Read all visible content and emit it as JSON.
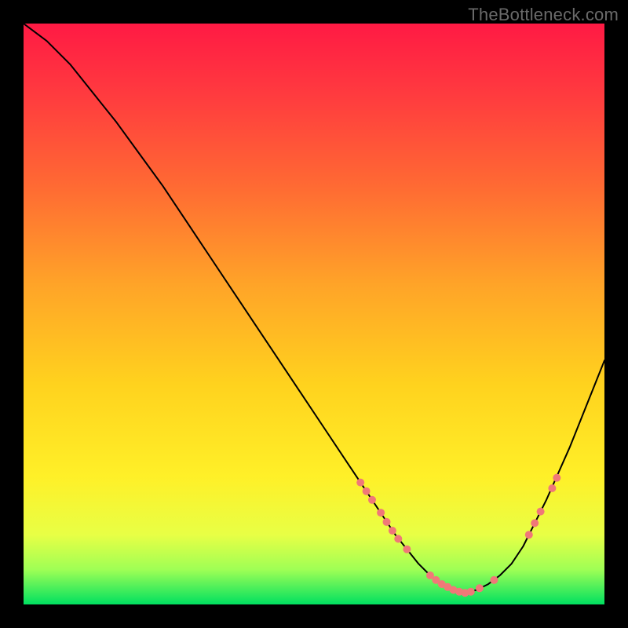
{
  "watermark": "TheBottleneck.com",
  "chart_data": {
    "type": "line",
    "title": "",
    "xlabel": "",
    "ylabel": "",
    "xlim": [
      0,
      100
    ],
    "ylim": [
      0,
      100
    ],
    "grid": false,
    "background_gradient": {
      "stops": [
        {
          "offset": 0.0,
          "color": "#ff1a44"
        },
        {
          "offset": 0.12,
          "color": "#ff3a3f"
        },
        {
          "offset": 0.28,
          "color": "#ff6a33"
        },
        {
          "offset": 0.45,
          "color": "#ffa428"
        },
        {
          "offset": 0.62,
          "color": "#ffd21e"
        },
        {
          "offset": 0.78,
          "color": "#fff028"
        },
        {
          "offset": 0.88,
          "color": "#e8ff45"
        },
        {
          "offset": 0.94,
          "color": "#9fff55"
        },
        {
          "offset": 1.0,
          "color": "#00e060"
        }
      ]
    },
    "series": [
      {
        "name": "curve",
        "stroke": "#000000",
        "stroke_width": 2,
        "x": [
          0,
          4,
          8,
          12,
          16,
          20,
          24,
          28,
          32,
          36,
          40,
          44,
          48,
          52,
          56,
          58,
          60,
          62,
          64,
          66,
          68,
          70,
          72,
          74,
          76,
          78,
          80,
          82,
          84,
          86,
          88,
          90,
          92,
          94,
          96,
          98,
          100
        ],
        "y": [
          100,
          97,
          93,
          88,
          83,
          77.5,
          72,
          66,
          60,
          54,
          48,
          42,
          36,
          30,
          24,
          21,
          18,
          15,
          12,
          9.5,
          7,
          5,
          3.5,
          2.5,
          2,
          2.5,
          3.5,
          5,
          7,
          10,
          14,
          18,
          22.5,
          27,
          32,
          37,
          42
        ]
      }
    ],
    "markers": {
      "color": "#f07878",
      "radius": 5,
      "points": [
        {
          "x": 58,
          "y": 21
        },
        {
          "x": 59,
          "y": 19.5
        },
        {
          "x": 60,
          "y": 18
        },
        {
          "x": 61.5,
          "y": 15.8
        },
        {
          "x": 62.5,
          "y": 14.2
        },
        {
          "x": 63.5,
          "y": 12.7
        },
        {
          "x": 64.5,
          "y": 11.3
        },
        {
          "x": 66,
          "y": 9.5
        },
        {
          "x": 70,
          "y": 5
        },
        {
          "x": 71,
          "y": 4.2
        },
        {
          "x": 72,
          "y": 3.5
        },
        {
          "x": 73,
          "y": 3
        },
        {
          "x": 74,
          "y": 2.5
        },
        {
          "x": 75,
          "y": 2.2
        },
        {
          "x": 76,
          "y": 2
        },
        {
          "x": 77,
          "y": 2.2
        },
        {
          "x": 78.5,
          "y": 2.8
        },
        {
          "x": 81,
          "y": 4.2
        },
        {
          "x": 87,
          "y": 12
        },
        {
          "x": 88,
          "y": 14
        },
        {
          "x": 89,
          "y": 16
        },
        {
          "x": 91,
          "y": 20
        },
        {
          "x": 91.8,
          "y": 21.8
        }
      ]
    }
  }
}
